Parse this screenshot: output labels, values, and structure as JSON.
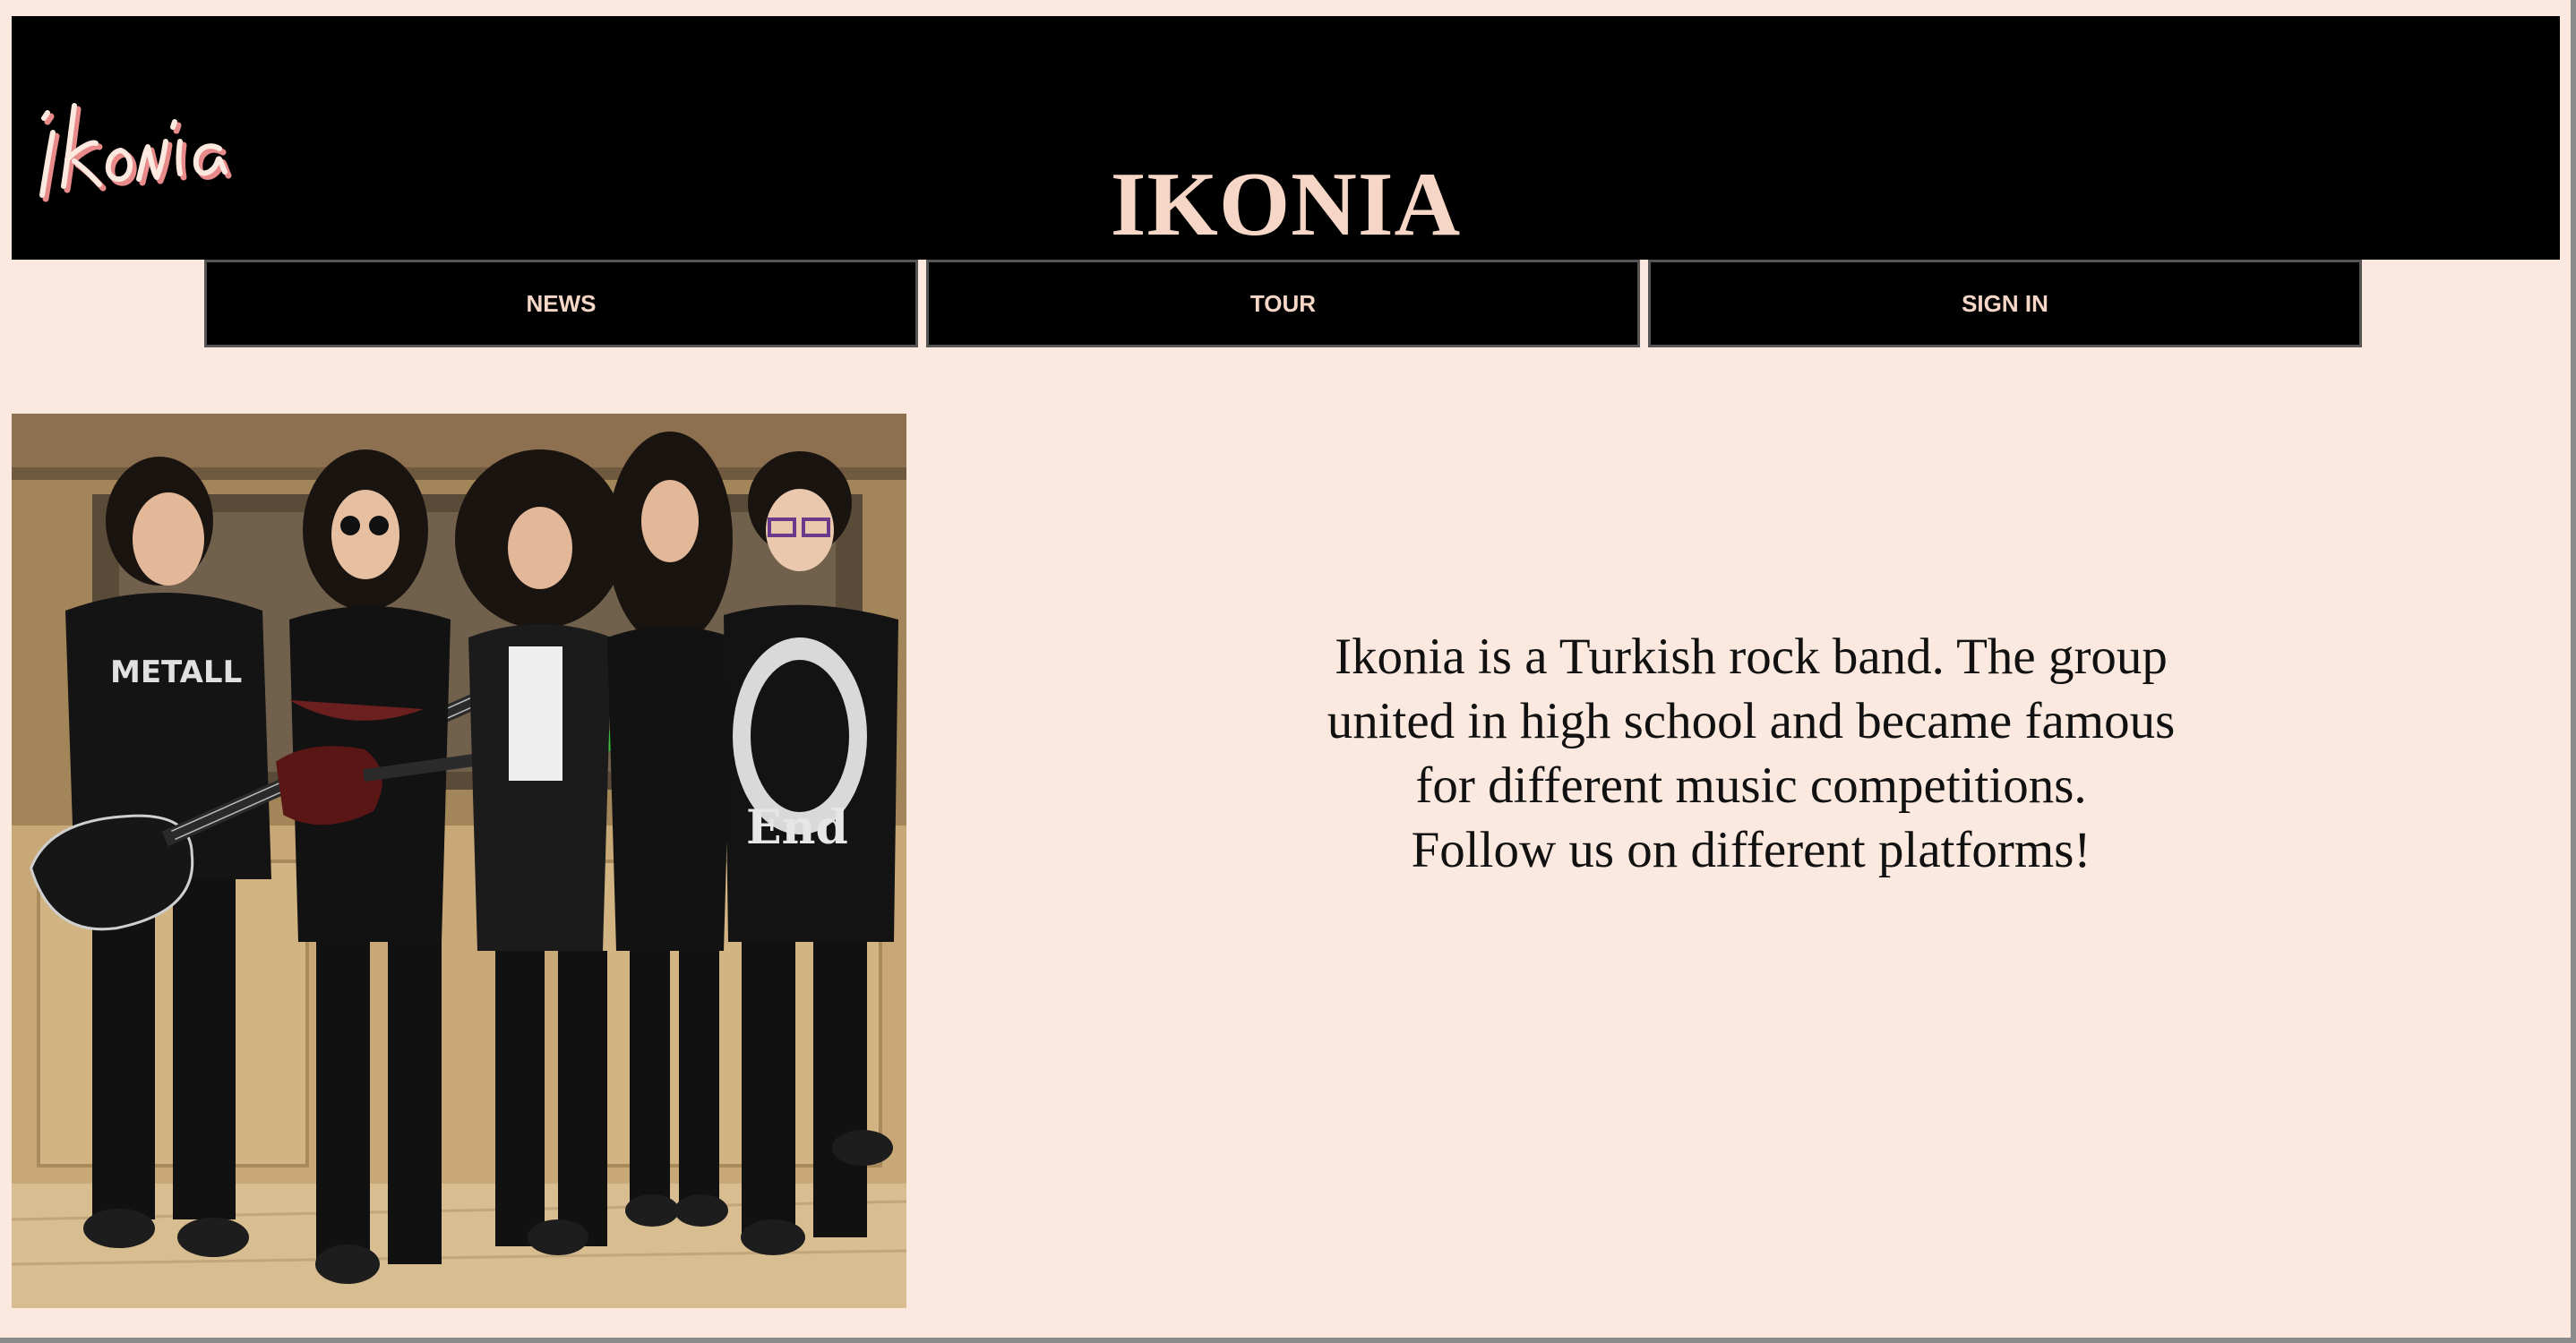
{
  "header": {
    "logo_text": "ikonia",
    "title": "IKONIA"
  },
  "nav": {
    "items": [
      {
        "label": "NEWS"
      },
      {
        "label": "TOUR"
      },
      {
        "label": "SIGN IN"
      }
    ]
  },
  "main": {
    "photo_description": "",
    "about_lines": [
      "Ikonia is a Turkish rock band. The group",
      "united in high school and became famous",
      "for different music competitions.",
      "Follow us on different platforms!"
    ]
  },
  "colors": {
    "page_background": "#fbe8df",
    "header_background": "#000000",
    "accent_text": "#f6d6c6"
  }
}
